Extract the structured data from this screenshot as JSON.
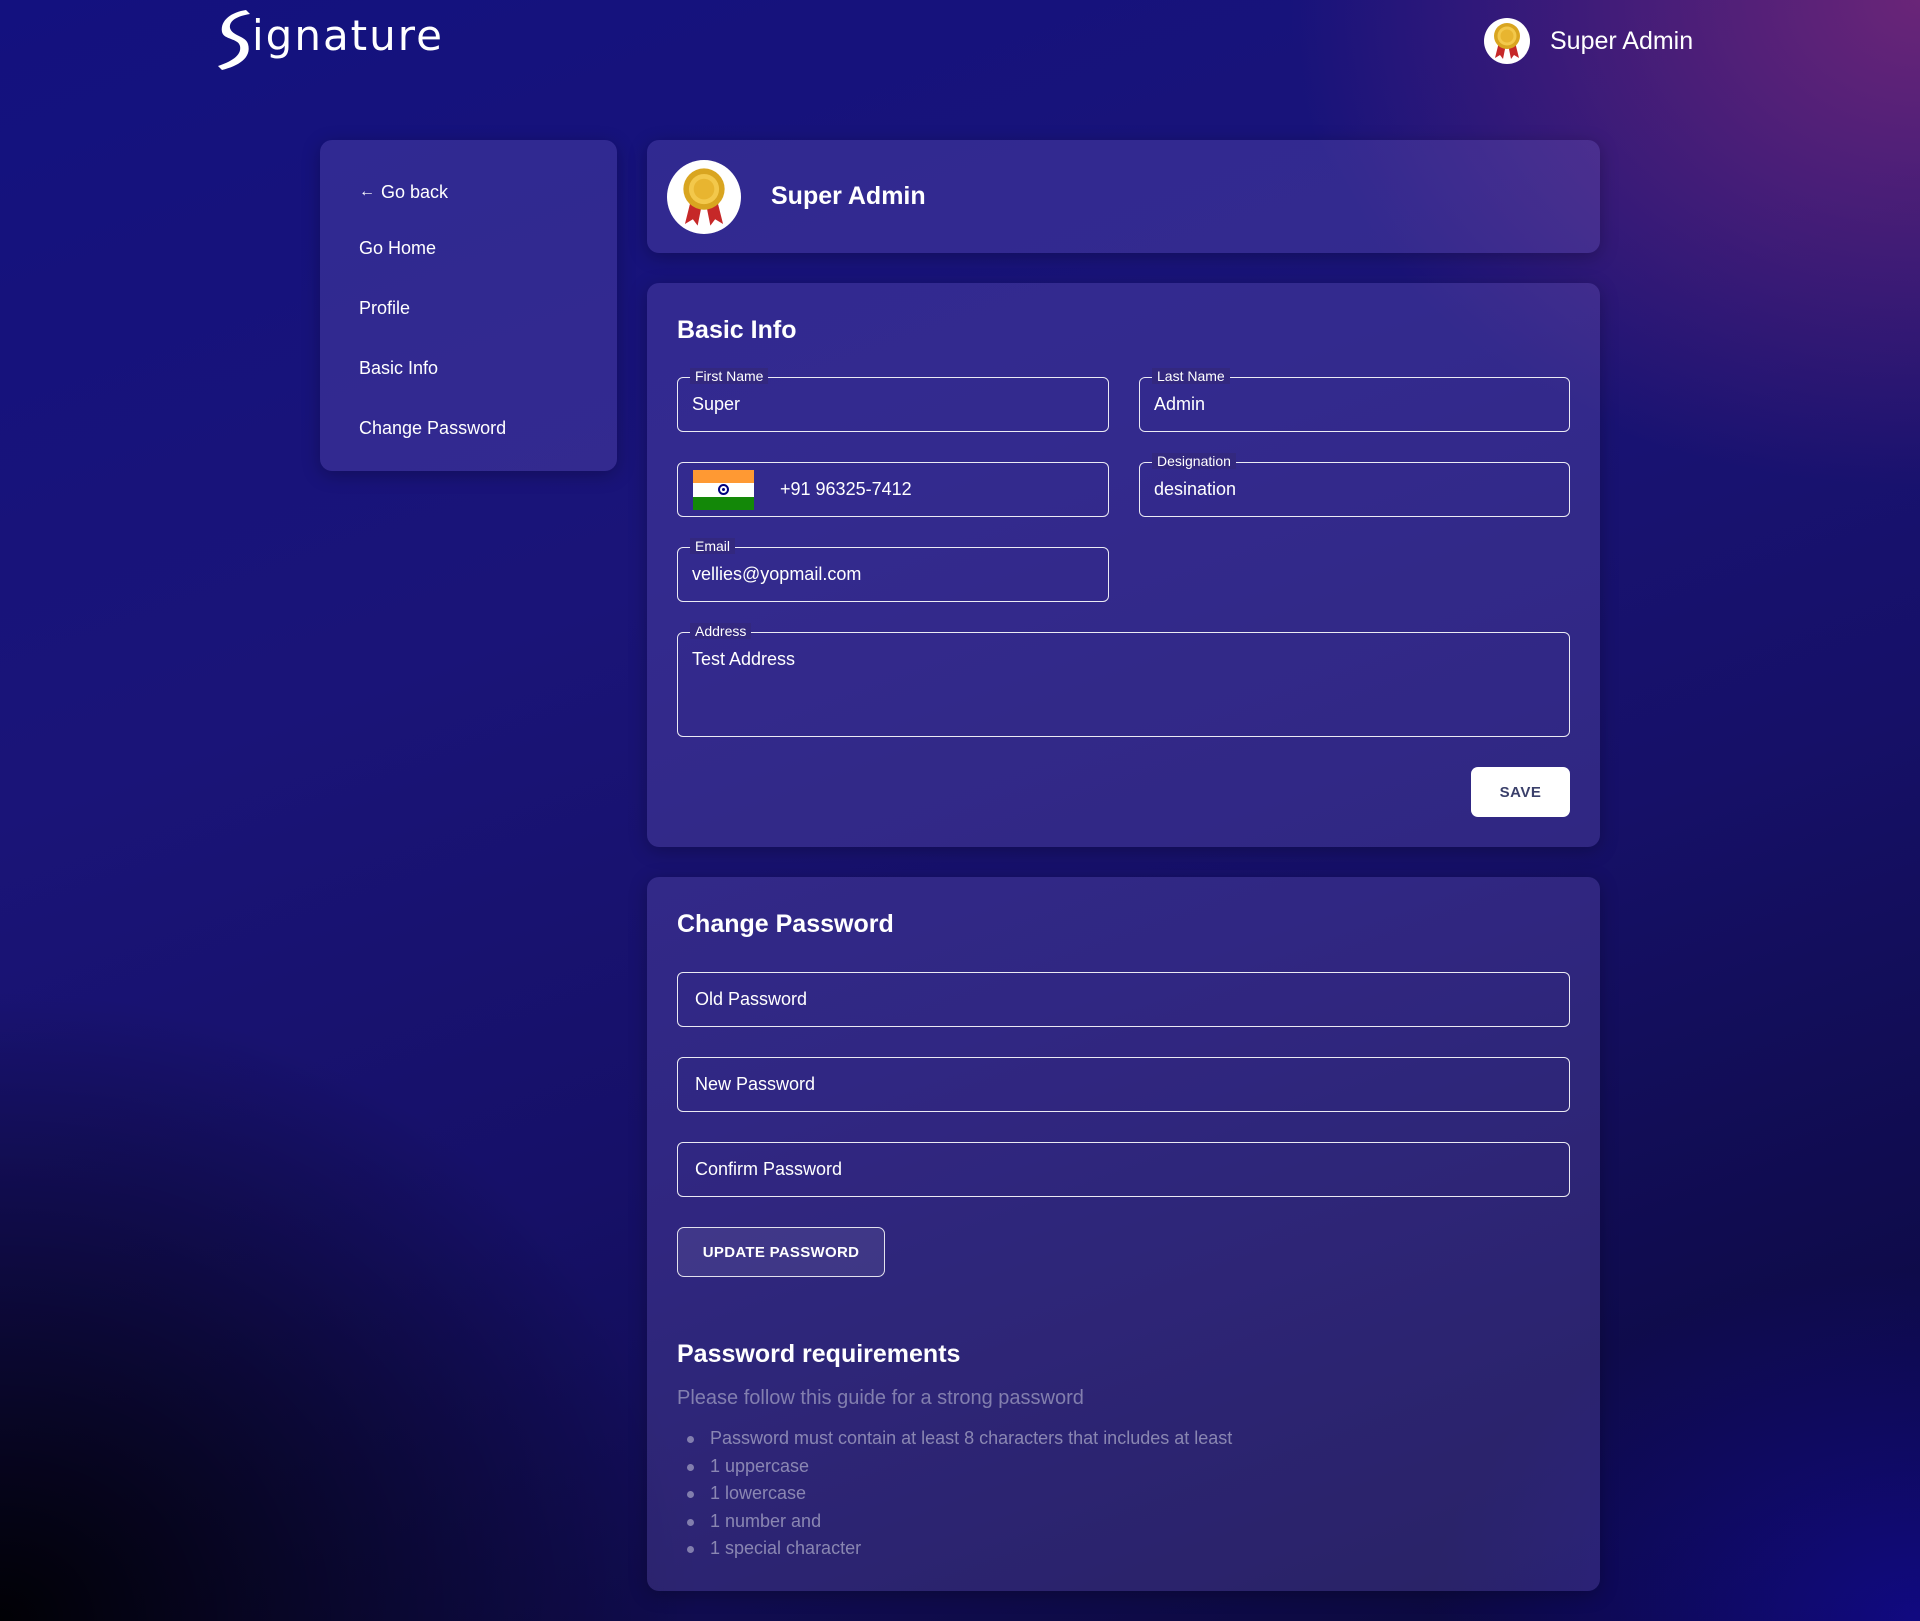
{
  "header": {
    "logo_text": "ignature",
    "user_name": "Super Admin"
  },
  "sidebar": {
    "back_arrow": "←",
    "items": [
      {
        "label": "Go back"
      },
      {
        "label": "Go Home"
      },
      {
        "label": "Profile"
      },
      {
        "label": "Basic Info"
      },
      {
        "label": "Change Password"
      }
    ]
  },
  "profile": {
    "name": "Super Admin"
  },
  "basic_info": {
    "title": "Basic Info",
    "first_name": {
      "label": "First Name",
      "value": "Super"
    },
    "last_name": {
      "label": "Last Name",
      "value": "Admin"
    },
    "phone": {
      "value": "+91 96325-7412",
      "flag": "india-flag"
    },
    "designation": {
      "label": "Designation",
      "value": "desination"
    },
    "email": {
      "label": "Email",
      "value": "vellies@yopmail.com"
    },
    "address": {
      "label": "Address",
      "value": "Test Address"
    },
    "save_label": "SAVE"
  },
  "change_password": {
    "title": "Change Password",
    "old_password_placeholder": "Old Password",
    "new_password_placeholder": "New Password",
    "confirm_password_placeholder": "Confirm Password",
    "update_label": "UPDATE PASSWORD",
    "requirements_title": "Password requirements",
    "requirements_subtitle": "Please follow this guide for a strong password",
    "requirements": [
      "Password must contain at least 8 characters that includes at least",
      "1 uppercase",
      "1 lowercase",
      "1 number and",
      "1 special character"
    ]
  },
  "colors": {
    "card_bg": "#4a3f9a",
    "save_text": "#3a3f6a",
    "flag_saffron": "#ff9933",
    "flag_green": "#138808",
    "flag_chakra": "#000080"
  }
}
